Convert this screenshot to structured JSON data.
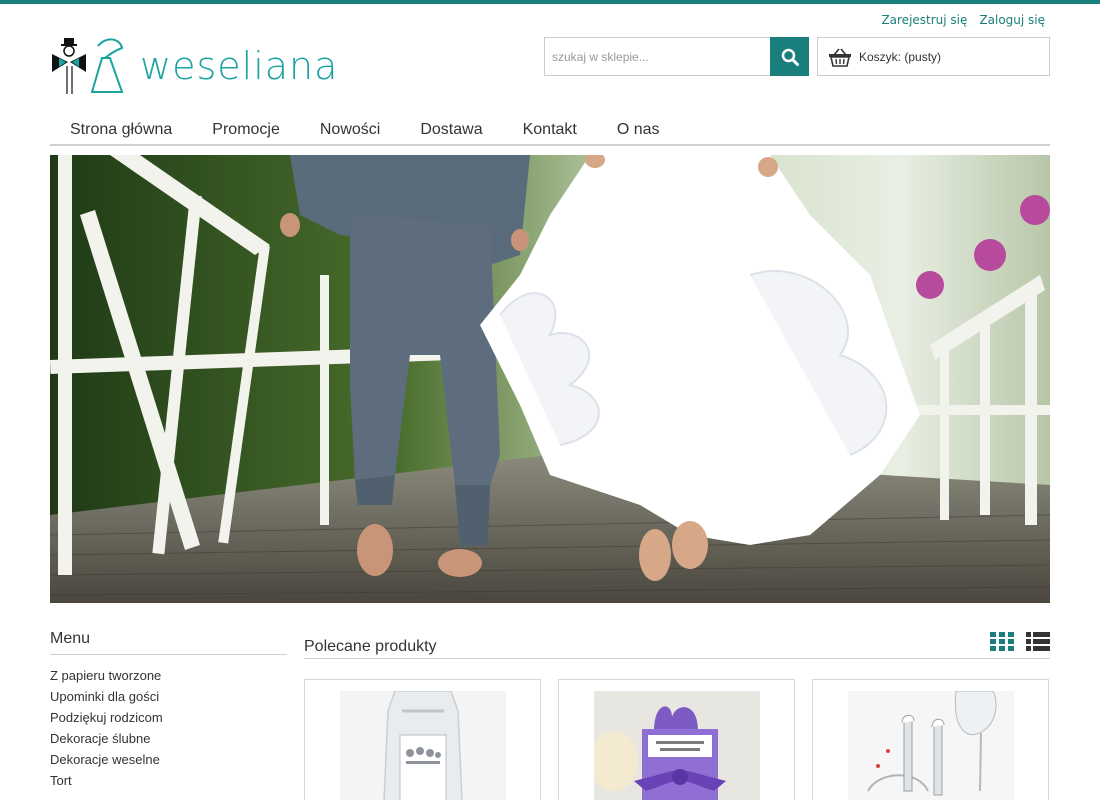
{
  "header": {
    "register_link": "Zarejestruj się",
    "login_link": "Zaloguj się",
    "logo_text": "weseliana",
    "search_placeholder": "szukaj w sklepie...",
    "cart_label": "Koszyk: (pusty)"
  },
  "nav": {
    "items": [
      "Strona główna",
      "Promocje",
      "Nowości",
      "Dostawa",
      "Kontakt",
      "O nas"
    ]
  },
  "sidebar": {
    "title": "Menu",
    "items": [
      "Z papieru tworzone",
      "Upominki dla gości",
      "Podziękuj rodzicom",
      "Dekoracje ślubne",
      "Dekoracje weselne",
      "Tort"
    ]
  },
  "main": {
    "title": "Polecane produkty"
  },
  "icons": {
    "search": "search-icon",
    "cart": "basket-icon",
    "grid_view": "grid-view-icon",
    "list_view": "list-view-icon"
  },
  "colors": {
    "accent": "#1a7f7c",
    "logo": "#1aa3a0"
  }
}
